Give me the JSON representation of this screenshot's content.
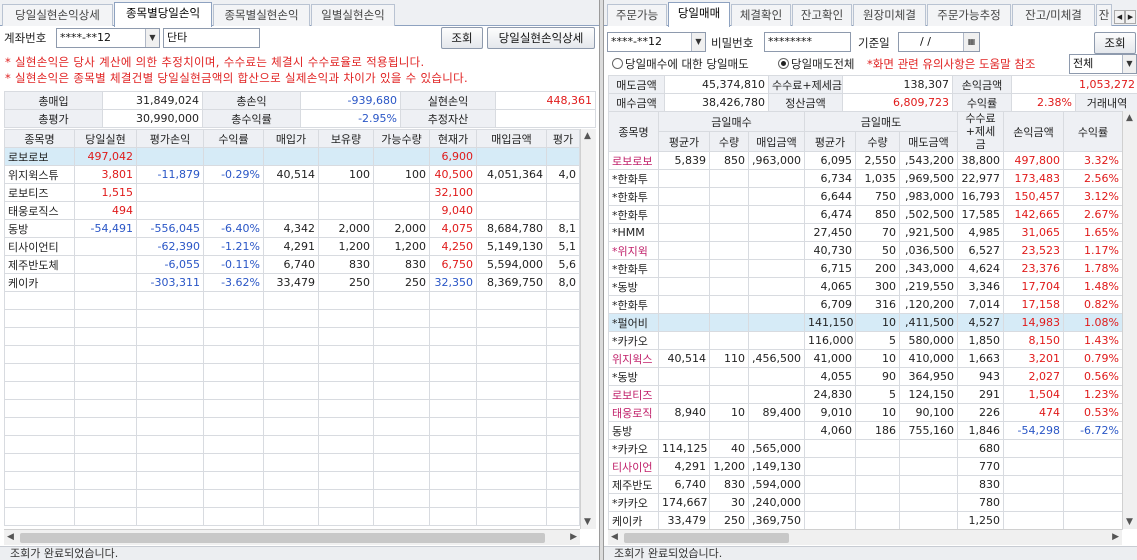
{
  "left": {
    "tabs": [
      "당일실현손익상세",
      "종목별당일손익",
      "종목별실현손익",
      "일별실현손익"
    ],
    "account_label": "계좌번호",
    "account_value": "****-**12",
    "type_value": "단타",
    "query_button": "조회",
    "detail_button": "당일실현손익상세",
    "notices": [
      "* 실현손익은 당사 계산에 의한 추정치이며, 수수료는 체결시 수수료율로 적용됩니다.",
      "* 실현손익은 종목별 체결건별 당일실현금액의 합산으로 실제손익과 차이가 있을 수 있습니다."
    ],
    "summary": [
      [
        {
          "label": "총매입",
          "value": "31,849,024"
        },
        {
          "label": "총손익",
          "value": "-939,680"
        },
        {
          "label": "실현손익",
          "value": "448,361"
        }
      ],
      [
        {
          "label": "총평가",
          "value": "30,990,000"
        },
        {
          "label": "총수익률",
          "value": "-2.95%"
        },
        {
          "label": "추정자산",
          "value": ""
        }
      ]
    ],
    "columns": [
      "종목명",
      "당일실현",
      "평가손익",
      "수익률",
      "매입가",
      "보유량",
      "가능수량",
      "현재가",
      "매입금액",
      "평가"
    ],
    "rows": [
      [
        "로보로보",
        "497,042",
        "",
        "",
        "",
        "",
        "",
        "6,900",
        "",
        ""
      ],
      [
        "위지윅스튜",
        "3,801",
        "-11,879",
        "-0.29%",
        "40,514",
        "100",
        "100",
        "40,500",
        "4,051,364",
        "4,0"
      ],
      [
        "로보티즈",
        "1,515",
        "",
        "",
        "",
        "",
        "",
        "32,100",
        "",
        ""
      ],
      [
        "태웅로직스",
        "494",
        "",
        "",
        "",
        "",
        "",
        "9,040",
        "",
        ""
      ],
      [
        "동방",
        "-54,491",
        "-556,045",
        "-6.40%",
        "4,342",
        "2,000",
        "2,000",
        "4,075",
        "8,684,780",
        "8,1"
      ],
      [
        "티사이언티",
        "",
        "-62,390",
        "-1.21%",
        "4,291",
        "1,200",
        "1,200",
        "4,250",
        "5,149,130",
        "5,1"
      ],
      [
        "제주반도체",
        "",
        "-6,055",
        "-0.11%",
        "6,740",
        "830",
        "830",
        "6,750",
        "5,594,000",
        "5,6"
      ],
      [
        "케이카",
        "",
        "-303,311",
        "-3.62%",
        "33,479",
        "250",
        "250",
        "32,350",
        "8,369,750",
        "8,0"
      ]
    ],
    "status": "조회가 완료되었습니다."
  },
  "right": {
    "tabs": [
      "주문가능",
      "당일매매",
      "체결확인",
      "잔고확인",
      "원장미체결",
      "주문가능추정",
      "잔고/미체결",
      "잔"
    ],
    "account_value": "****-**12",
    "pw_label": "비밀번호",
    "pw_value": "********",
    "date_label": "기준일",
    "date_value": "/  /",
    "query_button": "조회",
    "radio1": "당일매수에 대한 당일매도",
    "radio2": "당일매도전체",
    "notice": "*화면 관련 유의사항은 도움말 참조",
    "filter_value": "전체",
    "summary": [
      [
        {
          "label": "매도금액",
          "value": "45,374,810"
        },
        {
          "label": "수수료+제세금",
          "value": "138,307"
        },
        {
          "label": "손익금액",
          "value": "1,053,272"
        }
      ],
      [
        {
          "label": "매수금액",
          "value": "38,426,780"
        },
        {
          "label": "정산금액",
          "value": "6,809,723"
        },
        {
          "label": "수익률",
          "value": "2.38%"
        },
        {
          "label": "거래내역",
          "value": ""
        }
      ]
    ],
    "group_headers": {
      "name": "종목명",
      "buy": "금일매수",
      "sell": "금일매도",
      "fee": "수수료\n+제세금",
      "pl": "손익금액",
      "rate": "수익률"
    },
    "sub_headers": [
      "평균가",
      "수량",
      "매입금액",
      "평균가",
      "수량",
      "매도금액"
    ],
    "rows": [
      [
        "로보로보",
        "5,839",
        "850",
        ",963,000",
        "6,095",
        "2,550",
        ",543,200",
        "38,800",
        "497,800",
        "3.32%"
      ],
      [
        "*한화투",
        "",
        "",
        "",
        "6,734",
        "1,035",
        ",969,500",
        "22,977",
        "173,483",
        "2.56%"
      ],
      [
        "*한화투",
        "",
        "",
        "",
        "6,644",
        "750",
        ",983,000",
        "16,793",
        "150,457",
        "3.12%"
      ],
      [
        "*한화투",
        "",
        "",
        "",
        "6,474",
        "850",
        ",502,500",
        "17,585",
        "142,665",
        "2.67%"
      ],
      [
        "*HMM",
        "",
        "",
        "",
        "27,450",
        "70",
        ",921,500",
        "4,985",
        "31,065",
        "1.65%"
      ],
      [
        "*위지윅",
        "",
        "",
        "",
        "40,730",
        "50",
        ",036,500",
        "6,527",
        "23,523",
        "1.17%"
      ],
      [
        "*한화투",
        "",
        "",
        "",
        "6,715",
        "200",
        ",343,000",
        "4,624",
        "23,376",
        "1.78%"
      ],
      [
        "*동방",
        "",
        "",
        "",
        "4,065",
        "300",
        ",219,550",
        "3,346",
        "17,704",
        "1.48%"
      ],
      [
        "*한화투",
        "",
        "",
        "",
        "6,709",
        "316",
        ",120,200",
        "7,014",
        "17,158",
        "0.82%"
      ],
      [
        "*펄어비",
        "",
        "",
        "",
        "141,150",
        "10",
        ",411,500",
        "4,527",
        "14,983",
        "1.08%"
      ],
      [
        "*카카오",
        "",
        "",
        "",
        "116,000",
        "5",
        "580,000",
        "1,850",
        "8,150",
        "1.43%"
      ],
      [
        "위지윅스",
        "40,514",
        "110",
        ",456,500",
        "41,000",
        "10",
        "410,000",
        "1,663",
        "3,201",
        "0.79%"
      ],
      [
        "*동방",
        "",
        "",
        "",
        "4,055",
        "90",
        "364,950",
        "943",
        "2,027",
        "0.56%"
      ],
      [
        "로보티즈",
        "",
        "",
        "",
        "24,830",
        "5",
        "124,150",
        "291",
        "1,504",
        "1.23%"
      ],
      [
        "태웅로직",
        "8,940",
        "10",
        "89,400",
        "9,010",
        "10",
        "90,100",
        "226",
        "474",
        "0.53%"
      ],
      [
        "동방",
        "",
        "",
        "",
        "4,060",
        "186",
        "755,160",
        "1,846",
        "-54,298",
        "-6.72%"
      ],
      [
        "*카카오",
        "114,125",
        "40",
        ",565,000",
        "",
        "",
        "",
        "680",
        "",
        ""
      ],
      [
        "티사이언",
        "4,291",
        "1,200",
        ",149,130",
        "",
        "",
        "",
        "770",
        "",
        ""
      ],
      [
        "제주반도",
        "6,740",
        "830",
        ",594,000",
        "",
        "",
        "",
        "830",
        "",
        ""
      ],
      [
        "*카카오",
        "174,667",
        "30",
        ",240,000",
        "",
        "",
        "",
        "780",
        "",
        ""
      ],
      [
        "케이카",
        "33,479",
        "250",
        ",369,750",
        "",
        "",
        "",
        "1,250",
        "",
        ""
      ]
    ],
    "status": "조회가 완료되었습니다."
  }
}
